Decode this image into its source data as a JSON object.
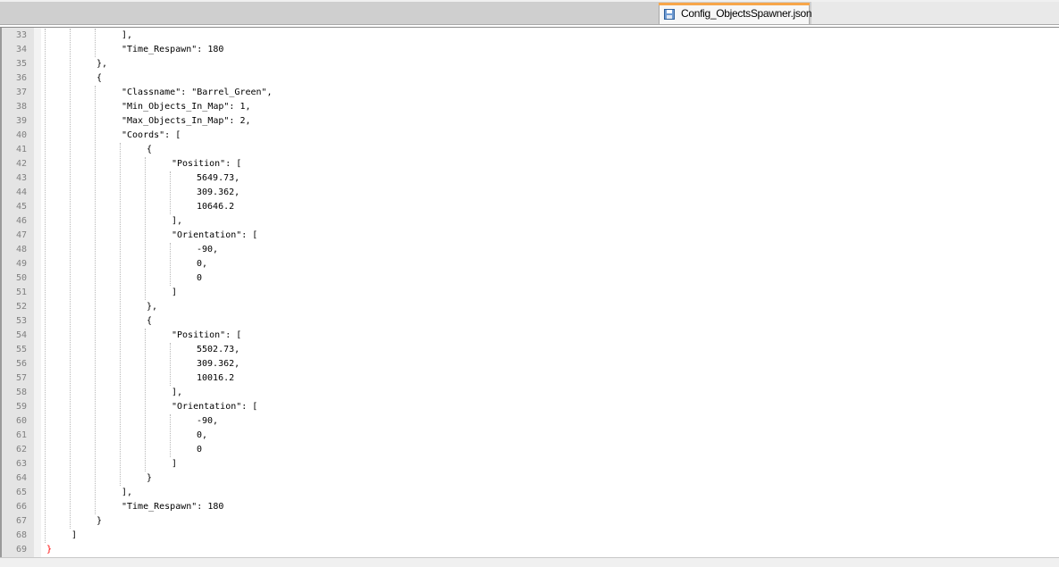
{
  "tab": {
    "label": "Config_ObjectsSpawner.json",
    "icon": "save-icon",
    "accent_color": "#f7a64a"
  },
  "lines": [
    {
      "n": "33",
      "text": "],",
      "indent": 3
    },
    {
      "n": "34",
      "text": "\"Time_Respawn\": 180",
      "indent": 3
    },
    {
      "n": "35",
      "text": "},",
      "indent": 2
    },
    {
      "n": "36",
      "text": "{",
      "indent": 2
    },
    {
      "n": "37",
      "text": "\"Classname\": \"Barrel_Green\",",
      "indent": 3
    },
    {
      "n": "38",
      "text": "\"Min_Objects_In_Map\": 1,",
      "indent": 3
    },
    {
      "n": "39",
      "text": "\"Max_Objects_In_Map\": 2,",
      "indent": 3
    },
    {
      "n": "40",
      "text": "\"Coords\": [",
      "indent": 3
    },
    {
      "n": "41",
      "text": "{",
      "indent": 4
    },
    {
      "n": "42",
      "text": "\"Position\": [",
      "indent": 5
    },
    {
      "n": "43",
      "text": "5649.73,",
      "indent": 6
    },
    {
      "n": "44",
      "text": "309.362,",
      "indent": 6
    },
    {
      "n": "45",
      "text": "10646.2",
      "indent": 6
    },
    {
      "n": "46",
      "text": "],",
      "indent": 5
    },
    {
      "n": "47",
      "text": "\"Orientation\": [",
      "indent": 5
    },
    {
      "n": "48",
      "text": "-90,",
      "indent": 6
    },
    {
      "n": "49",
      "text": "0,",
      "indent": 6
    },
    {
      "n": "50",
      "text": "0",
      "indent": 6
    },
    {
      "n": "51",
      "text": "]",
      "indent": 5
    },
    {
      "n": "52",
      "text": "},",
      "indent": 4
    },
    {
      "n": "53",
      "text": "{",
      "indent": 4
    },
    {
      "n": "54",
      "text": "\"Position\": [",
      "indent": 5
    },
    {
      "n": "55",
      "text": "5502.73,",
      "indent": 6
    },
    {
      "n": "56",
      "text": "309.362,",
      "indent": 6
    },
    {
      "n": "57",
      "text": "10016.2",
      "indent": 6
    },
    {
      "n": "58",
      "text": "],",
      "indent": 5
    },
    {
      "n": "59",
      "text": "\"Orientation\": [",
      "indent": 5
    },
    {
      "n": "60",
      "text": "-90,",
      "indent": 6
    },
    {
      "n": "61",
      "text": "0,",
      "indent": 6
    },
    {
      "n": "62",
      "text": "0",
      "indent": 6
    },
    {
      "n": "63",
      "text": "]",
      "indent": 5
    },
    {
      "n": "64",
      "text": "}",
      "indent": 4
    },
    {
      "n": "65",
      "text": "],",
      "indent": 3
    },
    {
      "n": "66",
      "text": "\"Time_Respawn\": 180",
      "indent": 3
    },
    {
      "n": "67",
      "text": "}",
      "indent": 2
    },
    {
      "n": "68",
      "text": "]",
      "indent": 1
    },
    {
      "n": "69",
      "text": "}",
      "indent": 0,
      "color": "#ff0000"
    }
  ]
}
